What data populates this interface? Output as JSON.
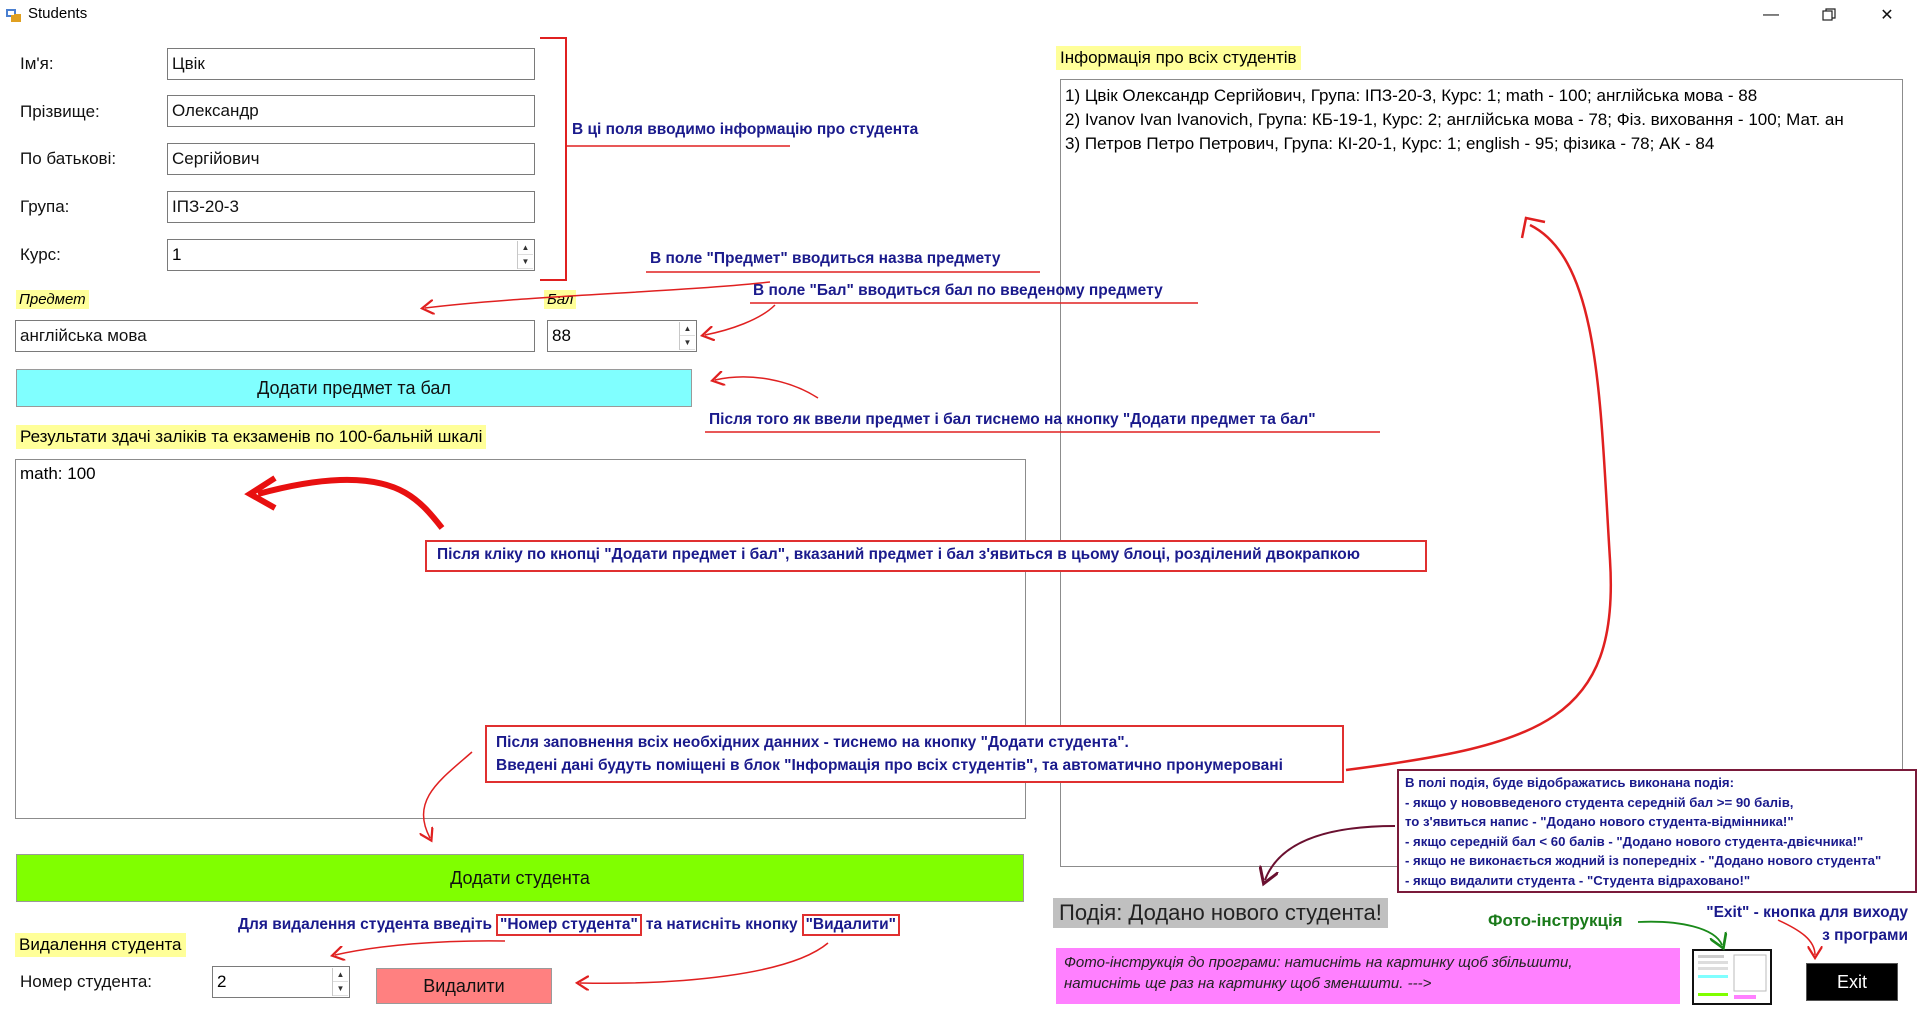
{
  "window": {
    "title": "Students",
    "controls": [
      "minimize-icon",
      "maximize-icon",
      "close-icon"
    ]
  },
  "form": {
    "name_label": "Ім'я:",
    "name_value": "Цвік",
    "surname_label": "Прізвище:",
    "surname_value": "Олександр",
    "patronymic_label": "По батькові:",
    "patronymic_value": "Сергійович",
    "group_label": "Група:",
    "group_value": "ІПЗ-20-3",
    "course_label": "Курс:",
    "course_value": "1",
    "subject_label": "Предмет",
    "subject_value": "англійська мова",
    "grade_label": "Бал",
    "grade_value": "88",
    "add_subject_button": "Додати предмет та бал",
    "results_label": "Результати здачі заліків та екзаменів по 100-бальній шкалі",
    "results_items": [
      "math: 100"
    ],
    "add_student_button": "Додати студента",
    "delete_section_label": "Видалення студента",
    "student_number_label": "Номер студента:",
    "student_number_value": "2",
    "delete_button": "Видалити"
  },
  "info": {
    "label": "Інформація про всіх студентів",
    "students": [
      "1) Цвік Олександр Сергійович, Група: ІПЗ-20-3, Курс: 1; math - 100; англійська мова - 88",
      "2) Ivanov Ivan Ivanovich, Група: КБ-19-1, Курс: 2; англійська мова - 78; Фіз. виховання - 100; Мат. ан",
      "3) Петров Петро Петрович, Група: КІ-20-1, Курс: 1; english - 95; фізика - 78; АК - 84"
    ]
  },
  "event": {
    "text": "Подія: Додано нового студента!"
  },
  "photo": {
    "instruction_line1": "Фото-інструкція до програми: натисніть на картинку щоб збільшити,",
    "instruction_line2": "натисніть ще раз на картинку щоб зменшити.  --->"
  },
  "exit_button": "Exit",
  "annotations": {
    "fields_note": "В ці поля вводимо інформацію про студента",
    "subject_note": "В поле \"Предмет\" вводиться назва предмету",
    "grade_note": "В поле \"Бал\" вводиться бал по введеному предмету",
    "add_subject_note": "Після того як ввели предмет і бал тиснемо на кнопку \"Додати предмет та бал\"",
    "results_note": "Після кліку по кнопці \"Додати предмет і бал\", вказаний предмет і бал з'явиться в цьому блоці, розділений двокрапкою",
    "add_student_note_line1": "Після заповнення всіх необхідних данних - тиснемо на кнопку \"Додати студента\".",
    "add_student_note_line2": "Введені дані будуть поміщені в блок \"Інформація про всіх студентів\", та автоматично пронумеровані",
    "event_note_lines": [
      "В полі подія, буде відображатись виконана подія:",
      "- якщо у нововведеного студента середній бал >= 90 балів,",
      "то з'явиться напис - \"Додано нового студента-відмінника!\"",
      "- якщо середній бал < 60 балів - \"Додано нового студента-двієчника!\"",
      "- якщо не виконається жодний із попередніх - \"Додано нового студента\"",
      "- якщо видалити студента - \"Студента відраховано!\""
    ],
    "delete_note_part1": "Для видалення студента введіть",
    "delete_note_part2": "\"Номер студента\"",
    "delete_note_part3": "та натисніть кнопку",
    "delete_note_part4": "\"Видалити\"",
    "photo_note": "Фото-інструкція",
    "exit_note_line1": "\"Exit\" - кнопка для виходу",
    "exit_note_line2": "з програми"
  },
  "colors": {
    "add_subject_button": "#80ffff",
    "add_student_button": "#80ff00",
    "delete_button": "#ff8080",
    "label_highlight": "#ffff99",
    "photo_instruction_bg": "#ff80ff",
    "event_bg": "#c0c0c0",
    "exit_button": "#000000",
    "annotation_text": "#1a1a8c",
    "annotation_border": "#e03030",
    "photo_note_text": "#1a7a1a",
    "event_note_border": "#7a1a3a"
  }
}
